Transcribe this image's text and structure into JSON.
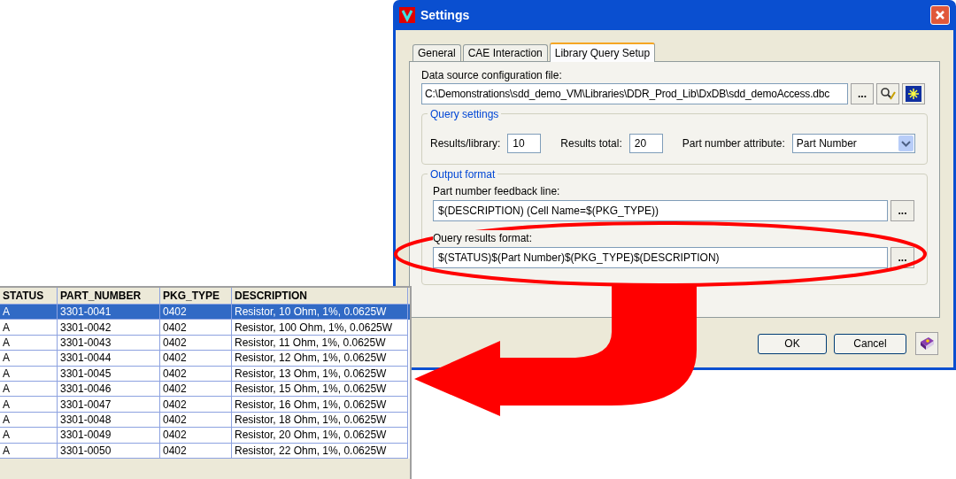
{
  "dialog": {
    "title": "Settings",
    "tabs": [
      {
        "label": "General",
        "selected": false
      },
      {
        "label": "CAE Interaction",
        "selected": false
      },
      {
        "label": "Library Query Setup",
        "selected": true
      }
    ],
    "data_source": {
      "label": "Data source configuration file:",
      "value": "C:\\Demonstrations\\sdd_demo_VM\\Libraries\\DDR_Prod_Lib\\DxDB\\sdd_demoAccess.dbc",
      "browse": "..."
    },
    "query_settings": {
      "title": "Query settings",
      "results_per_library": {
        "label": "Results/library:",
        "value": "10"
      },
      "results_total": {
        "label": "Results total:",
        "value": "20"
      },
      "part_number_attribute": {
        "label": "Part number attribute:",
        "value": "Part Number"
      }
    },
    "output_format": {
      "title": "Output format",
      "feedback_line": {
        "label": "Part number feedback line:",
        "value": "$(DESCRIPTION) (Cell Name=$(PKG_TYPE))",
        "browse": "..."
      },
      "results_format": {
        "label": "Query results format:",
        "value": "$(STATUS)$(Part Number)$(PKG_TYPE)$(DESCRIPTION)",
        "browse": "..."
      }
    },
    "buttons": [
      "OK",
      "Cancel"
    ]
  },
  "results_table": {
    "columns": [
      "STATUS",
      "PART_NUMBER",
      "PKG_TYPE",
      "DESCRIPTION"
    ],
    "rows": [
      {
        "cells": [
          "A",
          "3301-0041",
          "0402",
          "Resistor, 10 Ohm, 1%, 0.0625W"
        ],
        "selected": true
      },
      {
        "cells": [
          "A",
          "3301-0042",
          "0402",
          "Resistor, 100 Ohm, 1%, 0.0625W"
        ],
        "selected": false
      },
      {
        "cells": [
          "A",
          "3301-0043",
          "0402",
          "Resistor, 11 Ohm, 1%, 0.0625W"
        ],
        "selected": false
      },
      {
        "cells": [
          "A",
          "3301-0044",
          "0402",
          "Resistor, 12 Ohm, 1%, 0.0625W"
        ],
        "selected": false
      },
      {
        "cells": [
          "A",
          "3301-0045",
          "0402",
          "Resistor, 13 Ohm, 1%, 0.0625W"
        ],
        "selected": false
      },
      {
        "cells": [
          "A",
          "3301-0046",
          "0402",
          "Resistor, 15 Ohm, 1%, 0.0625W"
        ],
        "selected": false
      },
      {
        "cells": [
          "A",
          "3301-0047",
          "0402",
          "Resistor, 16 Ohm, 1%, 0.0625W"
        ],
        "selected": false
      },
      {
        "cells": [
          "A",
          "3301-0048",
          "0402",
          "Resistor, 18 Ohm, 1%, 0.0625W"
        ],
        "selected": false
      },
      {
        "cells": [
          "A",
          "3301-0049",
          "0402",
          "Resistor, 20 Ohm, 1%, 0.0625W"
        ],
        "selected": false
      },
      {
        "cells": [
          "A",
          "3301-0050",
          "0402",
          "Resistor, 22 Ohm, 1%, 0.0625W"
        ],
        "selected": false
      }
    ]
  }
}
